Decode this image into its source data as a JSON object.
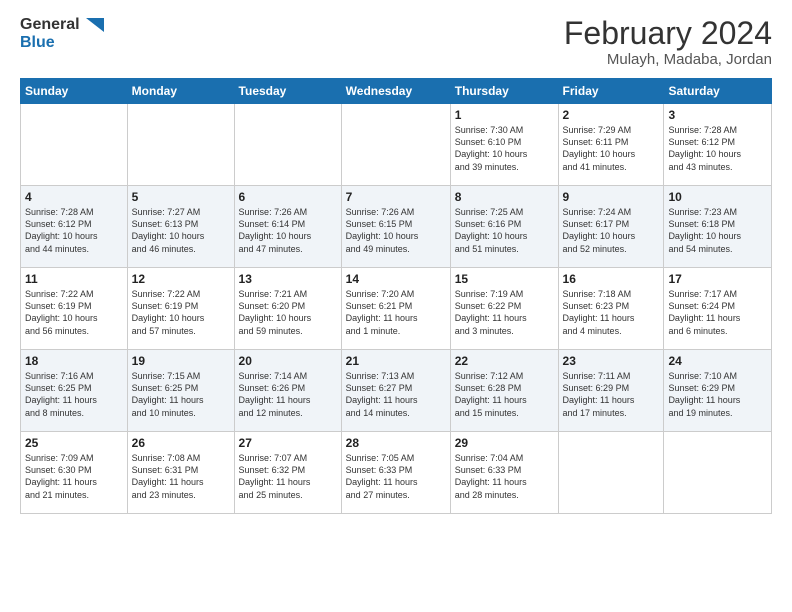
{
  "logo": {
    "line1": "General",
    "line2": "Blue"
  },
  "title": "February 2024",
  "location": "Mulayh, Madaba, Jordan",
  "weekdays": [
    "Sunday",
    "Monday",
    "Tuesday",
    "Wednesday",
    "Thursday",
    "Friday",
    "Saturday"
  ],
  "weeks": [
    [
      {
        "day": "",
        "info": ""
      },
      {
        "day": "",
        "info": ""
      },
      {
        "day": "",
        "info": ""
      },
      {
        "day": "",
        "info": ""
      },
      {
        "day": "1",
        "info": "Sunrise: 7:30 AM\nSunset: 6:10 PM\nDaylight: 10 hours\nand 39 minutes."
      },
      {
        "day": "2",
        "info": "Sunrise: 7:29 AM\nSunset: 6:11 PM\nDaylight: 10 hours\nand 41 minutes."
      },
      {
        "day": "3",
        "info": "Sunrise: 7:28 AM\nSunset: 6:12 PM\nDaylight: 10 hours\nand 43 minutes."
      }
    ],
    [
      {
        "day": "4",
        "info": "Sunrise: 7:28 AM\nSunset: 6:12 PM\nDaylight: 10 hours\nand 44 minutes."
      },
      {
        "day": "5",
        "info": "Sunrise: 7:27 AM\nSunset: 6:13 PM\nDaylight: 10 hours\nand 46 minutes."
      },
      {
        "day": "6",
        "info": "Sunrise: 7:26 AM\nSunset: 6:14 PM\nDaylight: 10 hours\nand 47 minutes."
      },
      {
        "day": "7",
        "info": "Sunrise: 7:26 AM\nSunset: 6:15 PM\nDaylight: 10 hours\nand 49 minutes."
      },
      {
        "day": "8",
        "info": "Sunrise: 7:25 AM\nSunset: 6:16 PM\nDaylight: 10 hours\nand 51 minutes."
      },
      {
        "day": "9",
        "info": "Sunrise: 7:24 AM\nSunset: 6:17 PM\nDaylight: 10 hours\nand 52 minutes."
      },
      {
        "day": "10",
        "info": "Sunrise: 7:23 AM\nSunset: 6:18 PM\nDaylight: 10 hours\nand 54 minutes."
      }
    ],
    [
      {
        "day": "11",
        "info": "Sunrise: 7:22 AM\nSunset: 6:19 PM\nDaylight: 10 hours\nand 56 minutes."
      },
      {
        "day": "12",
        "info": "Sunrise: 7:22 AM\nSunset: 6:19 PM\nDaylight: 10 hours\nand 57 minutes."
      },
      {
        "day": "13",
        "info": "Sunrise: 7:21 AM\nSunset: 6:20 PM\nDaylight: 10 hours\nand 59 minutes."
      },
      {
        "day": "14",
        "info": "Sunrise: 7:20 AM\nSunset: 6:21 PM\nDaylight: 11 hours\nand 1 minute."
      },
      {
        "day": "15",
        "info": "Sunrise: 7:19 AM\nSunset: 6:22 PM\nDaylight: 11 hours\nand 3 minutes."
      },
      {
        "day": "16",
        "info": "Sunrise: 7:18 AM\nSunset: 6:23 PM\nDaylight: 11 hours\nand 4 minutes."
      },
      {
        "day": "17",
        "info": "Sunrise: 7:17 AM\nSunset: 6:24 PM\nDaylight: 11 hours\nand 6 minutes."
      }
    ],
    [
      {
        "day": "18",
        "info": "Sunrise: 7:16 AM\nSunset: 6:25 PM\nDaylight: 11 hours\nand 8 minutes."
      },
      {
        "day": "19",
        "info": "Sunrise: 7:15 AM\nSunset: 6:25 PM\nDaylight: 11 hours\nand 10 minutes."
      },
      {
        "day": "20",
        "info": "Sunrise: 7:14 AM\nSunset: 6:26 PM\nDaylight: 11 hours\nand 12 minutes."
      },
      {
        "day": "21",
        "info": "Sunrise: 7:13 AM\nSunset: 6:27 PM\nDaylight: 11 hours\nand 14 minutes."
      },
      {
        "day": "22",
        "info": "Sunrise: 7:12 AM\nSunset: 6:28 PM\nDaylight: 11 hours\nand 15 minutes."
      },
      {
        "day": "23",
        "info": "Sunrise: 7:11 AM\nSunset: 6:29 PM\nDaylight: 11 hours\nand 17 minutes."
      },
      {
        "day": "24",
        "info": "Sunrise: 7:10 AM\nSunset: 6:29 PM\nDaylight: 11 hours\nand 19 minutes."
      }
    ],
    [
      {
        "day": "25",
        "info": "Sunrise: 7:09 AM\nSunset: 6:30 PM\nDaylight: 11 hours\nand 21 minutes."
      },
      {
        "day": "26",
        "info": "Sunrise: 7:08 AM\nSunset: 6:31 PM\nDaylight: 11 hours\nand 23 minutes."
      },
      {
        "day": "27",
        "info": "Sunrise: 7:07 AM\nSunset: 6:32 PM\nDaylight: 11 hours\nand 25 minutes."
      },
      {
        "day": "28",
        "info": "Sunrise: 7:05 AM\nSunset: 6:33 PM\nDaylight: 11 hours\nand 27 minutes."
      },
      {
        "day": "29",
        "info": "Sunrise: 7:04 AM\nSunset: 6:33 PM\nDaylight: 11 hours\nand 28 minutes."
      },
      {
        "day": "",
        "info": ""
      },
      {
        "day": "",
        "info": ""
      }
    ]
  ]
}
